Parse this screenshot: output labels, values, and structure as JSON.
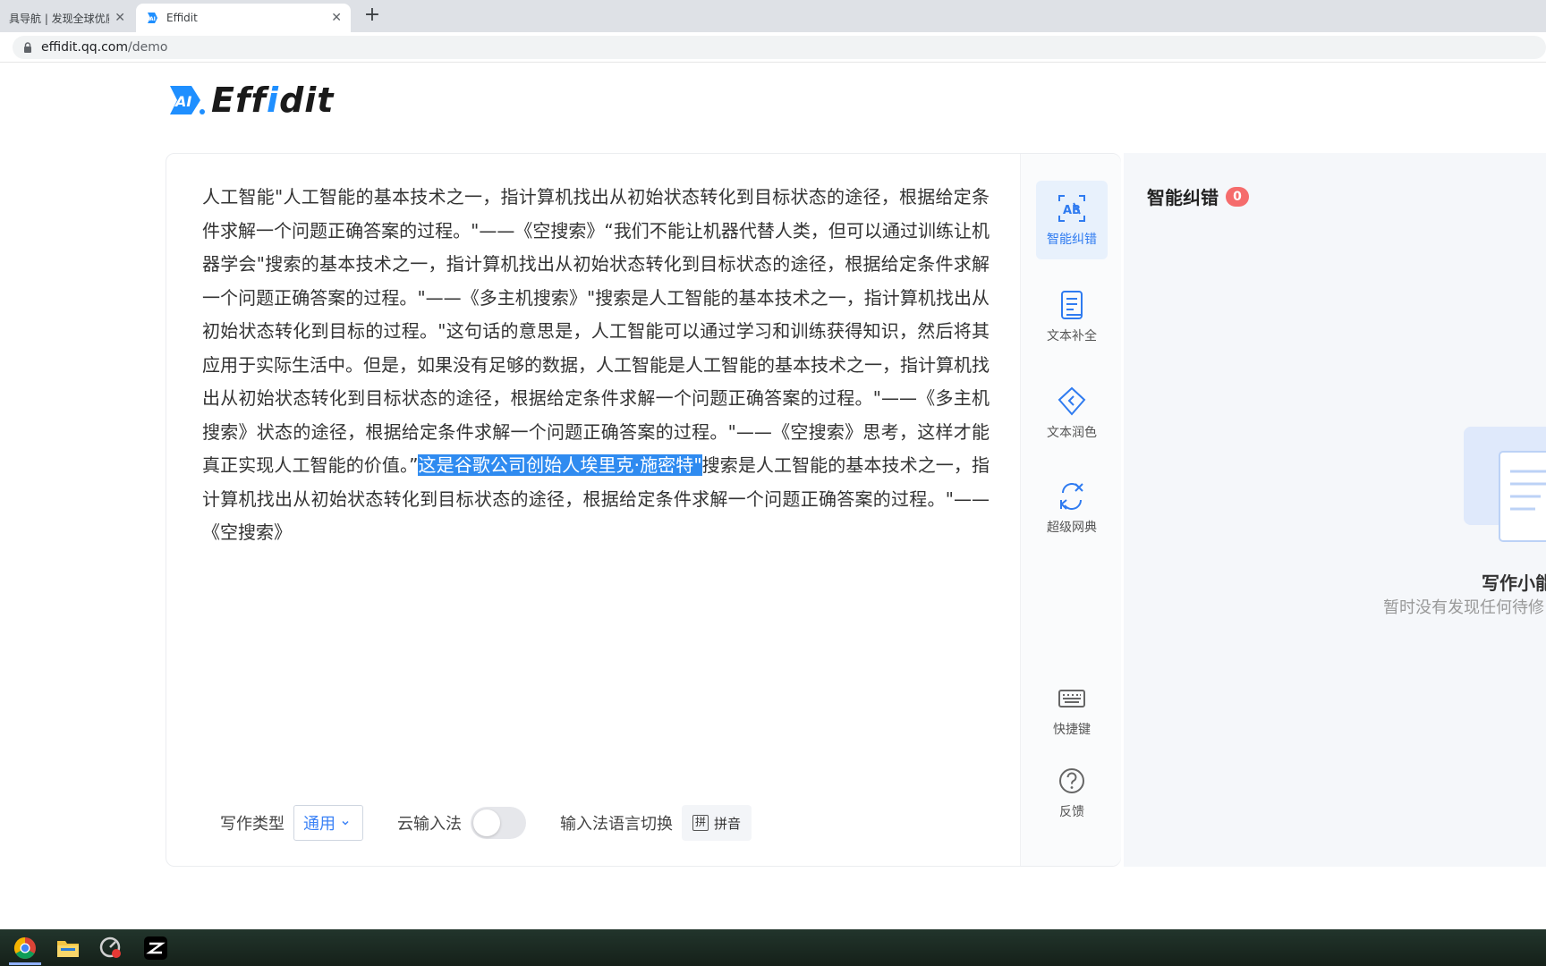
{
  "browser": {
    "tabs": [
      {
        "title": "具导航 | 发现全球优质AI工",
        "active": false
      },
      {
        "title": "Effidit",
        "active": true
      }
    ],
    "new_tab_symbol": "+",
    "close_symbol": "✕",
    "url_host": "effidit.qq.com",
    "url_path": "/demo"
  },
  "logo": {
    "badge": "AI",
    "text_a": "Eff",
    "text_i": "i",
    "text_b": "dit"
  },
  "editor": {
    "text_before": "人工智能\"人工智能的基本技术之一，指计算机找出从初始状态转化到目标状态的途径，根据给定条件求解一个问题正确答案的过程。\"——《空搜索》“我们不能让机器代替人类，但可以通过训练让机器学会\"搜索的基本技术之一，指计算机找出从初始状态转化到目标状态的途径，根据给定条件求解一个问题正确答案的过程。\"——《多主机搜索》\"搜索是人工智能的基本技术之一，指计算机找出从初始状态转化到目标的过程。\"这句话的意思是，人工智能可以通过学习和训练获得知识，然后将其应用于实际生活中。但是，如果没有足够的数据，人工智能是人工智能的基本技术之一，指计算机找出从初始状态转化到目标状态的途径，根据给定条件求解一个问题正确答案的过程。\"——《多主机搜索》状态的途径，根据给定条件求解一个问题正确答案的过程。\"——《空搜索》思考，这样才能真正实现人工智能的价值。”",
    "text_highlight": "这是谷歌公司创始人埃里克·施密特\"",
    "text_after": "搜索是人工智能的基本技术之一，指计算机找出从初始状态转化到目标状态的途径，根据给定条件求解一个问题正确答案的过程。\"——《空搜索》"
  },
  "bottom_bar": {
    "writing_type_label": "写作类型",
    "writing_type_value": "通用",
    "cloud_ime_label": "云输入法",
    "cloud_ime_on": false,
    "ime_lang_label": "输入法语言切换",
    "ime_lang_icon": "拼",
    "ime_lang_value": "拼音"
  },
  "toolbar": {
    "items": [
      {
        "label": "智能纠错",
        "icon": "ab-correct-icon",
        "active": true
      },
      {
        "label": "文本补全",
        "icon": "document-icon",
        "active": false
      },
      {
        "label": "文本润色",
        "icon": "diamond-icon",
        "active": false
      },
      {
        "label": "超级网典",
        "icon": "translate-icon",
        "active": false
      },
      {
        "label": "快捷键",
        "icon": "keyboard-icon",
        "active": false
      },
      {
        "label": "反馈",
        "icon": "help-icon",
        "active": false
      }
    ]
  },
  "panel": {
    "title": "智能纠错",
    "count": "0",
    "empty_title": "写作小能",
    "empty_desc": "暂时没有发现任何待修"
  },
  "colors": {
    "accent": "#2f8bf0",
    "badge": "#f56c6c",
    "panel_bg": "#f5f7fa"
  }
}
